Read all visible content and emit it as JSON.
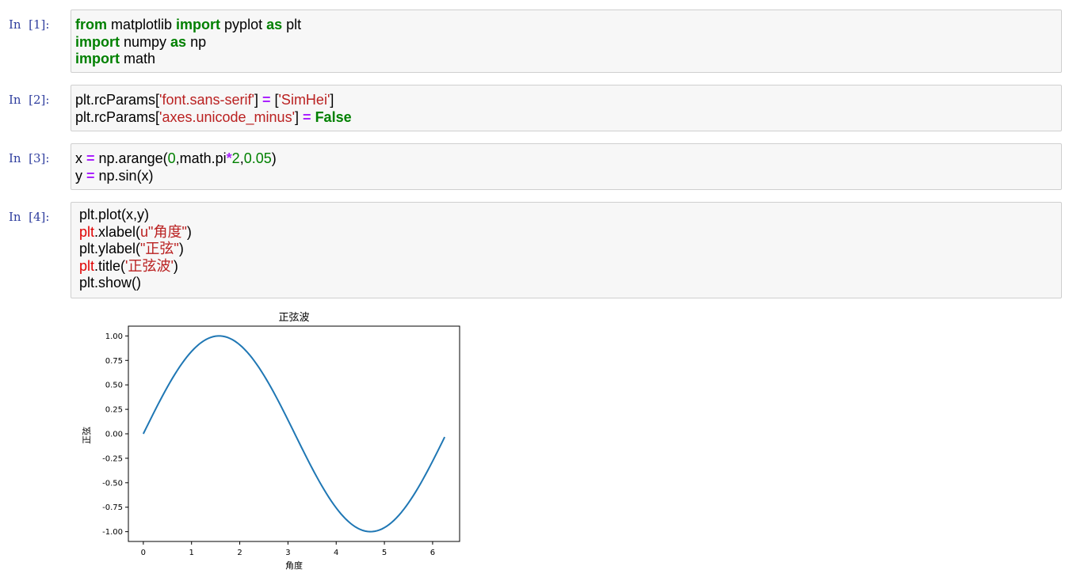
{
  "cells": [
    {
      "prompt": "In  [1]:",
      "lines": [
        [
          {
            "t": "from",
            "c": "kw"
          },
          {
            "t": " matplotlib ",
            "c": "plain"
          },
          {
            "t": "import",
            "c": "kw"
          },
          {
            "t": " pyplot ",
            "c": "plain"
          },
          {
            "t": "as",
            "c": "kw"
          },
          {
            "t": " plt",
            "c": "plain"
          }
        ],
        [
          {
            "t": "import",
            "c": "kw"
          },
          {
            "t": " numpy ",
            "c": "plain"
          },
          {
            "t": "as",
            "c": "kw"
          },
          {
            "t": " np",
            "c": "plain"
          }
        ],
        [
          {
            "t": "import",
            "c": "kw"
          },
          {
            "t": " math",
            "c": "plain"
          }
        ]
      ]
    },
    {
      "prompt": "In  [2]:",
      "lines": [
        [
          {
            "t": "plt.rcParams[",
            "c": "plain"
          },
          {
            "t": "'font.sans-serif'",
            "c": "str"
          },
          {
            "t": "] ",
            "c": "plain"
          },
          {
            "t": "=",
            "c": "op"
          },
          {
            "t": " [",
            "c": "plain"
          },
          {
            "t": "'SimHei'",
            "c": "str"
          },
          {
            "t": "]",
            "c": "plain"
          }
        ],
        [
          {
            "t": "plt.rcParams[",
            "c": "plain"
          },
          {
            "t": "'axes.unicode_minus'",
            "c": "str"
          },
          {
            "t": "] ",
            "c": "plain"
          },
          {
            "t": "=",
            "c": "op"
          },
          {
            "t": " ",
            "c": "plain"
          },
          {
            "t": "False",
            "c": "kw"
          }
        ]
      ]
    },
    {
      "prompt": "In  [3]:",
      "lines": [
        [
          {
            "t": "x ",
            "c": "plain"
          },
          {
            "t": "=",
            "c": "op"
          },
          {
            "t": " np.arange(",
            "c": "plain"
          },
          {
            "t": "0",
            "c": "num"
          },
          {
            "t": ",math.pi",
            "c": "plain"
          },
          {
            "t": "*",
            "c": "op"
          },
          {
            "t": "2",
            "c": "num"
          },
          {
            "t": ",",
            "c": "plain"
          },
          {
            "t": "0.05",
            "c": "num"
          },
          {
            "t": ")",
            "c": "plain"
          }
        ],
        [
          {
            "t": "y ",
            "c": "plain"
          },
          {
            "t": "=",
            "c": "op"
          },
          {
            "t": " np.sin(x)",
            "c": "plain"
          }
        ]
      ]
    },
    {
      "prompt": "In  [4]:",
      "lines": [
        [
          {
            "t": " plt.plot(x,y)",
            "c": "plain"
          }
        ],
        [
          {
            "t": " plt",
            "c": "red"
          },
          {
            "t": ".xlabel(",
            "c": "plain"
          },
          {
            "t": "u\"角度\"",
            "c": "str"
          },
          {
            "t": ")",
            "c": "plain"
          }
        ],
        [
          {
            "t": " plt.ylabel(",
            "c": "plain"
          },
          {
            "t": "\"正弦\"",
            "c": "str"
          },
          {
            "t": ")",
            "c": "plain"
          }
        ],
        [
          {
            "t": " plt",
            "c": "red"
          },
          {
            "t": ".title(",
            "c": "plain"
          },
          {
            "t": "'正弦波'",
            "c": "str"
          },
          {
            "t": ")",
            "c": "plain"
          }
        ],
        [
          {
            "t": " plt.show()",
            "c": "plain"
          }
        ]
      ]
    }
  ],
  "chart_data": {
    "type": "line",
    "title": "正弦波",
    "xlabel": "角度",
    "ylabel": "正弦",
    "x_start": 0,
    "x_end": 6.25,
    "x_step": 0.05,
    "function": "sin",
    "xlim": [
      -0.31,
      6.56
    ],
    "ylim": [
      -1.1,
      1.1
    ],
    "xticks": [
      0,
      1,
      2,
      3,
      4,
      5,
      6
    ],
    "xtick_labels": [
      "0",
      "1",
      "2",
      "3",
      "4",
      "5",
      "6"
    ],
    "yticks": [
      1.0,
      0.75,
      0.5,
      0.25,
      0.0,
      -0.25,
      -0.5,
      -0.75,
      -1.0
    ],
    "ytick_labels": [
      "1.00",
      "0.75",
      "0.50",
      "0.25",
      "0.00",
      "-0.25",
      "-0.50",
      "-0.75",
      "-1.00"
    ],
    "line_color": "#1f77b4",
    "grid": false
  }
}
